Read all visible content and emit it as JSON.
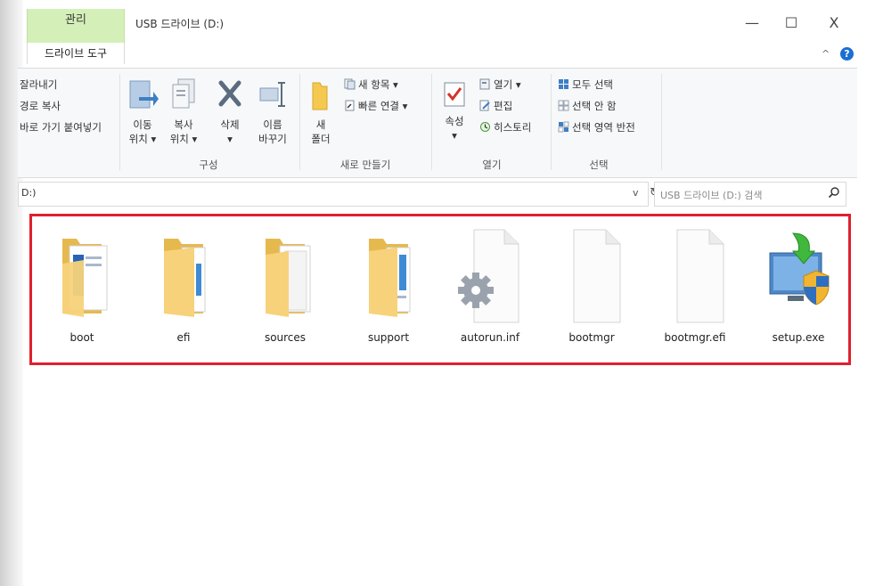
{
  "window": {
    "title": "USB 드라이브 (D:)",
    "manage_tab": "관리",
    "drive_tools_tab": "드라이브 도구",
    "minimize": "—",
    "maximize": "☐",
    "close": "X",
    "collapse": "^",
    "help": "?"
  },
  "ribbon": {
    "clipboard": {
      "cut": "잘라내기",
      "copy_path": "경로 복사",
      "paste_shortcut": "바로 가기 붙여넣기"
    },
    "organize": {
      "move_to_1": "이동",
      "move_to_2": "위치 ▾",
      "copy_to_1": "복사",
      "copy_to_2": "위치 ▾",
      "delete_1": "삭제",
      "delete_2": "▾",
      "rename_1": "이름",
      "rename_2": "바꾸기",
      "caption": "구성"
    },
    "new": {
      "folder_1": "새",
      "folder_2": "폴더",
      "new_item": "새 항목 ▾",
      "easy_access": "빠른 연결 ▾",
      "caption": "새로 만들기"
    },
    "open": {
      "properties_1": "속성",
      "properties_2": "▾",
      "open": "열기 ▾",
      "edit": "편집",
      "history": "히스토리",
      "caption": "열기"
    },
    "select": {
      "select_all": "모두 선택",
      "select_none": "선택 안 함",
      "invert": "선택 영역 반전",
      "caption": "선택"
    }
  },
  "address": {
    "path": "D:)",
    "dropdown": "v",
    "refresh": "↻"
  },
  "search": {
    "placeholder": "USB 드라이브 (D:) 검색"
  },
  "files": [
    {
      "name": "boot"
    },
    {
      "name": "efi"
    },
    {
      "name": "sources"
    },
    {
      "name": "support"
    },
    {
      "name": "autorun.inf"
    },
    {
      "name": "bootmgr"
    },
    {
      "name": "bootmgr.efi"
    },
    {
      "name": "setup.exe"
    }
  ],
  "colors": {
    "manage_tab_bg": "#d4f0b8",
    "highlight_border": "#e0202e",
    "folder_yellow": "#f7d27a",
    "help_blue": "#1a6fd3"
  }
}
